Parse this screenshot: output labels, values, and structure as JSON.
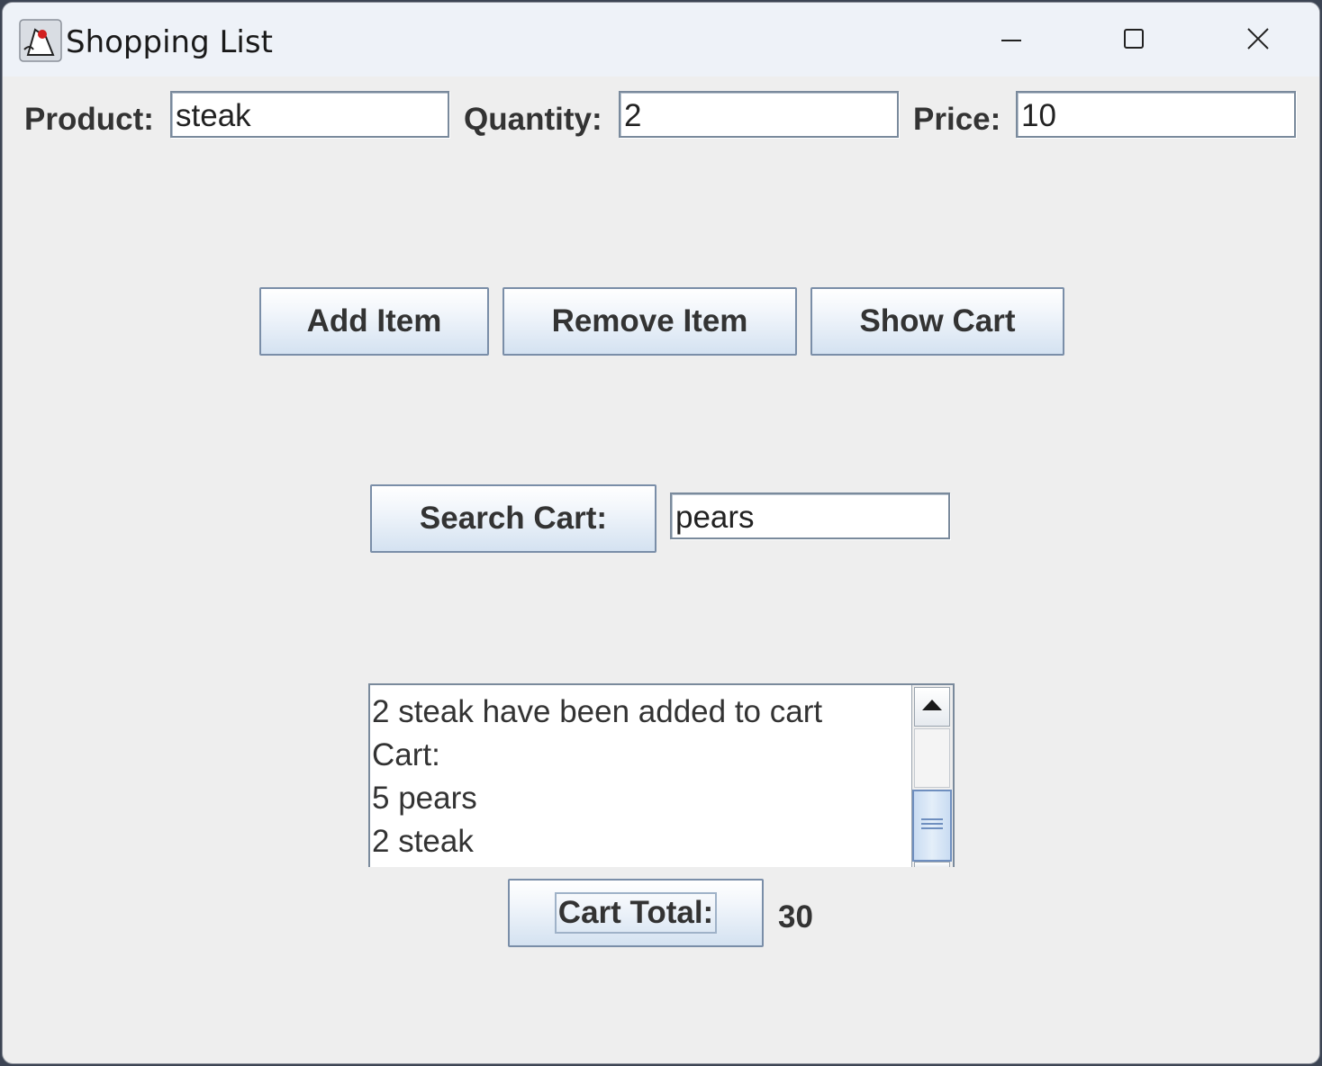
{
  "window": {
    "title": "Shopping List"
  },
  "form": {
    "product_label": "Product:",
    "product_value": "steak",
    "quantity_label": "Quantity:",
    "quantity_value": "2",
    "price_label": "Price:",
    "price_value": "10"
  },
  "actions": {
    "add_label": "Add Item",
    "remove_label": "Remove Item",
    "show_label": "Show Cart"
  },
  "search": {
    "button_label": "Search Cart:",
    "value": "pears"
  },
  "output": {
    "lines": [
      "2 steak have been added to cart",
      "Cart:",
      "5 pears",
      "2 steak"
    ]
  },
  "total": {
    "button_label": "Cart Total:",
    "value": "30"
  },
  "icons": {
    "app": "java-duke-icon",
    "minimize": "minimize-icon",
    "maximize": "maximize-icon",
    "close": "close-icon",
    "scroll_up": "arrow-up-icon",
    "scroll_grip": "grip-icon"
  },
  "colors": {
    "window_bg": "#eeeeee",
    "titlebar_bg": "#eef2f8",
    "button_border": "#7a8ea8",
    "scroll_thumb_border": "#6f8fbf"
  }
}
